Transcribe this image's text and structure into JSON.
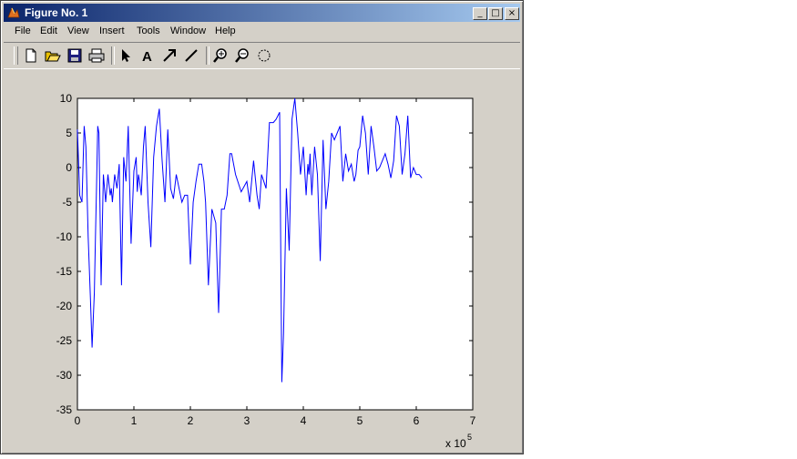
{
  "window": {
    "title": "Figure No. 1"
  },
  "title_buttons": {
    "minimize": "_",
    "maximize": "□",
    "close": "×"
  },
  "menu": [
    "File",
    "Edit",
    "View",
    "Insert",
    "Tools",
    "Window",
    "Help"
  ],
  "toolbar": [
    "new-figure",
    "open-file",
    "save",
    "print",
    "edit-plot-arrow",
    "insert-text",
    "insert-arrow",
    "insert-line",
    "zoom-in",
    "zoom-out",
    "rotate-3d"
  ],
  "chart_data": {
    "type": "line",
    "color": "#0000ff",
    "xlim": [
      0,
      7
    ],
    "ylim": [
      -35,
      10
    ],
    "xticks": [
      "0",
      "1",
      "2",
      "3",
      "4",
      "5",
      "6",
      "7"
    ],
    "yticks": [
      "10",
      "5",
      "0",
      "-5",
      "-10",
      "-15",
      "-20",
      "-25",
      "-30",
      "-35"
    ],
    "x_multiplier": "x 10",
    "x_multiplier_exp": "5",
    "x": [
      0,
      0.04,
      0.08,
      0.12,
      0.15,
      0.19,
      0.23,
      0.26,
      0.3,
      0.32,
      0.34,
      0.36,
      0.38,
      0.42,
      0.46,
      0.5,
      0.54,
      0.58,
      0.6,
      0.62,
      0.66,
      0.7,
      0.74,
      0.78,
      0.82,
      0.86,
      0.9,
      0.95,
      1.0,
      1.04,
      1.06,
      1.08,
      1.1,
      1.13,
      1.17,
      1.2,
      1.25,
      1.3,
      1.35,
      1.4,
      1.45,
      1.5,
      1.55,
      1.6,
      1.65,
      1.7,
      1.75,
      1.8,
      1.85,
      1.9,
      1.95,
      2.0,
      2.05,
      2.1,
      2.15,
      2.2,
      2.24,
      2.27,
      2.32,
      2.38,
      2.45,
      2.5,
      2.55,
      2.6,
      2.65,
      2.7,
      2.73,
      2.8,
      2.9,
      3.0,
      3.05,
      3.12,
      3.18,
      3.22,
      3.26,
      3.3,
      3.34,
      3.4,
      3.47,
      3.52,
      3.58,
      3.62,
      3.65,
      3.7,
      3.75,
      3.8,
      3.85,
      3.9,
      3.95,
      4.0,
      4.05,
      4.08,
      4.1,
      4.12,
      4.15,
      4.2,
      4.25,
      4.3,
      4.35,
      4.4,
      4.45,
      4.5,
      4.55,
      4.6,
      4.65,
      4.7,
      4.75,
      4.8,
      4.85,
      4.9,
      4.93,
      4.97,
      5.0,
      5.05,
      5.1,
      5.15,
      5.2,
      5.25,
      5.3,
      5.35,
      5.4,
      5.45,
      5.5,
      5.55,
      5.6,
      5.65,
      5.7,
      5.75,
      5.8,
      5.85,
      5.9,
      5.95,
      6.0,
      6.05,
      6.1
    ],
    "y": [
      5.5,
      -4,
      -5,
      6,
      3,
      -10,
      -19,
      -26,
      -18,
      -10,
      -2,
      6,
      5,
      -17,
      -1,
      -5,
      -1,
      -4,
      -3,
      -5,
      -1,
      -3,
      0.5,
      -17,
      1.5,
      -2,
      6,
      -11,
      -0.5,
      1.5,
      -3.5,
      -1,
      -2,
      -4,
      3,
      6,
      -5,
      -11.5,
      1.5,
      6,
      8.5,
      1,
      -5,
      5.5,
      -3,
      -4.5,
      -1,
      -3,
      -5,
      -4,
      -4,
      -14,
      -5,
      -2,
      0.5,
      0.5,
      -2,
      -5,
      -17,
      -6,
      -8,
      -21,
      -6,
      -6,
      -4,
      2,
      2,
      -1,
      -3.5,
      -2,
      -5,
      1,
      -4,
      -6,
      -1,
      -2,
      -3,
      6.5,
      6.5,
      7,
      8,
      -31,
      -24,
      -3,
      -12,
      7,
      10,
      5,
      -1,
      3,
      -4,
      0.5,
      -1,
      2,
      -4,
      3,
      -1,
      -13.5,
      4,
      -6,
      -2,
      5,
      4,
      5,
      6,
      -2,
      2,
      -0.5,
      0.5,
      -2,
      -1,
      2.5,
      3,
      7.5,
      5,
      -1,
      6,
      3,
      -0.5,
      0,
      1,
      2,
      0.5,
      -1.5,
      1,
      7.5,
      6,
      -1,
      2,
      7.5,
      -1.5,
      0,
      -1,
      -1,
      -1.5
    ]
  }
}
